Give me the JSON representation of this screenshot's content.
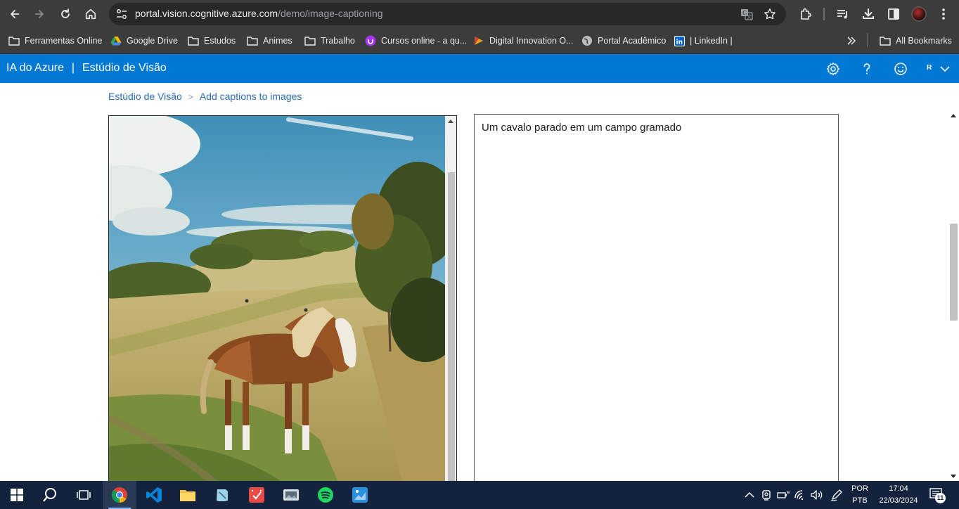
{
  "browser": {
    "url_domain": "portal.vision.cognitive.azure.com",
    "url_path": "/demo/image-captioning",
    "icons": {
      "back": "back-arrow-icon",
      "forward": "forward-arrow-icon",
      "reload": "reload-icon",
      "home": "home-icon",
      "site_info": "tune-icon",
      "translate": "translate-icon",
      "bookmark": "star-icon",
      "extensions": "puzzle-icon",
      "media": "media-queue-icon",
      "downloads": "download-icon",
      "side_panel": "side-panel-icon",
      "menu": "kebab-menu-icon"
    }
  },
  "bookmarks": {
    "items": [
      {
        "label": "Ferramentas Online",
        "icon": "folder-icon"
      },
      {
        "label": "Google Drive",
        "icon": "google-drive-icon"
      },
      {
        "label": "Estudos",
        "icon": "folder-icon"
      },
      {
        "label": "Animes",
        "icon": "folder-icon"
      },
      {
        "label": "Trabalho",
        "icon": "folder-icon"
      },
      {
        "label": "Cursos online - a qu...",
        "icon": "udemy-icon"
      },
      {
        "label": "Digital Innovation O...",
        "icon": "dio-icon"
      },
      {
        "label": "Portal Acadêmico",
        "icon": "globe-icon"
      },
      {
        "label": "| LinkedIn |",
        "icon": "linkedin-icon"
      }
    ],
    "overflow_icon": "chevron-double-right-icon",
    "all_bookmarks": "All Bookmarks"
  },
  "azure": {
    "product": "IA do Azure",
    "separator": "|",
    "studio": "Estúdio de Visão",
    "user_initial": "R",
    "icons": {
      "settings": "gear-icon",
      "help": "help-icon",
      "feedback": "smiley-icon",
      "account_menu": "chevron-down-icon"
    },
    "color": "#0078d4"
  },
  "breadcrumb": {
    "root": "Estúdio de Visão",
    "separator": ">",
    "current": "Add captions to images"
  },
  "result": {
    "image_alt": "horse standing in a grassy field",
    "caption": "Um cavalo parado em um campo gramado"
  },
  "taskbar": {
    "apps": [
      "windows-start-icon",
      "search-icon",
      "task-view-icon",
      "chrome-icon",
      "vscode-icon",
      "file-explorer-icon",
      "notes-app-icon",
      "calendar-app-icon",
      "photos-app-icon",
      "spotify-icon",
      "paint-app-icon"
    ],
    "language_top": "POR",
    "language_bottom": "PTB",
    "time": "17:04",
    "date": "22/03/2024",
    "notification_count": "11"
  }
}
